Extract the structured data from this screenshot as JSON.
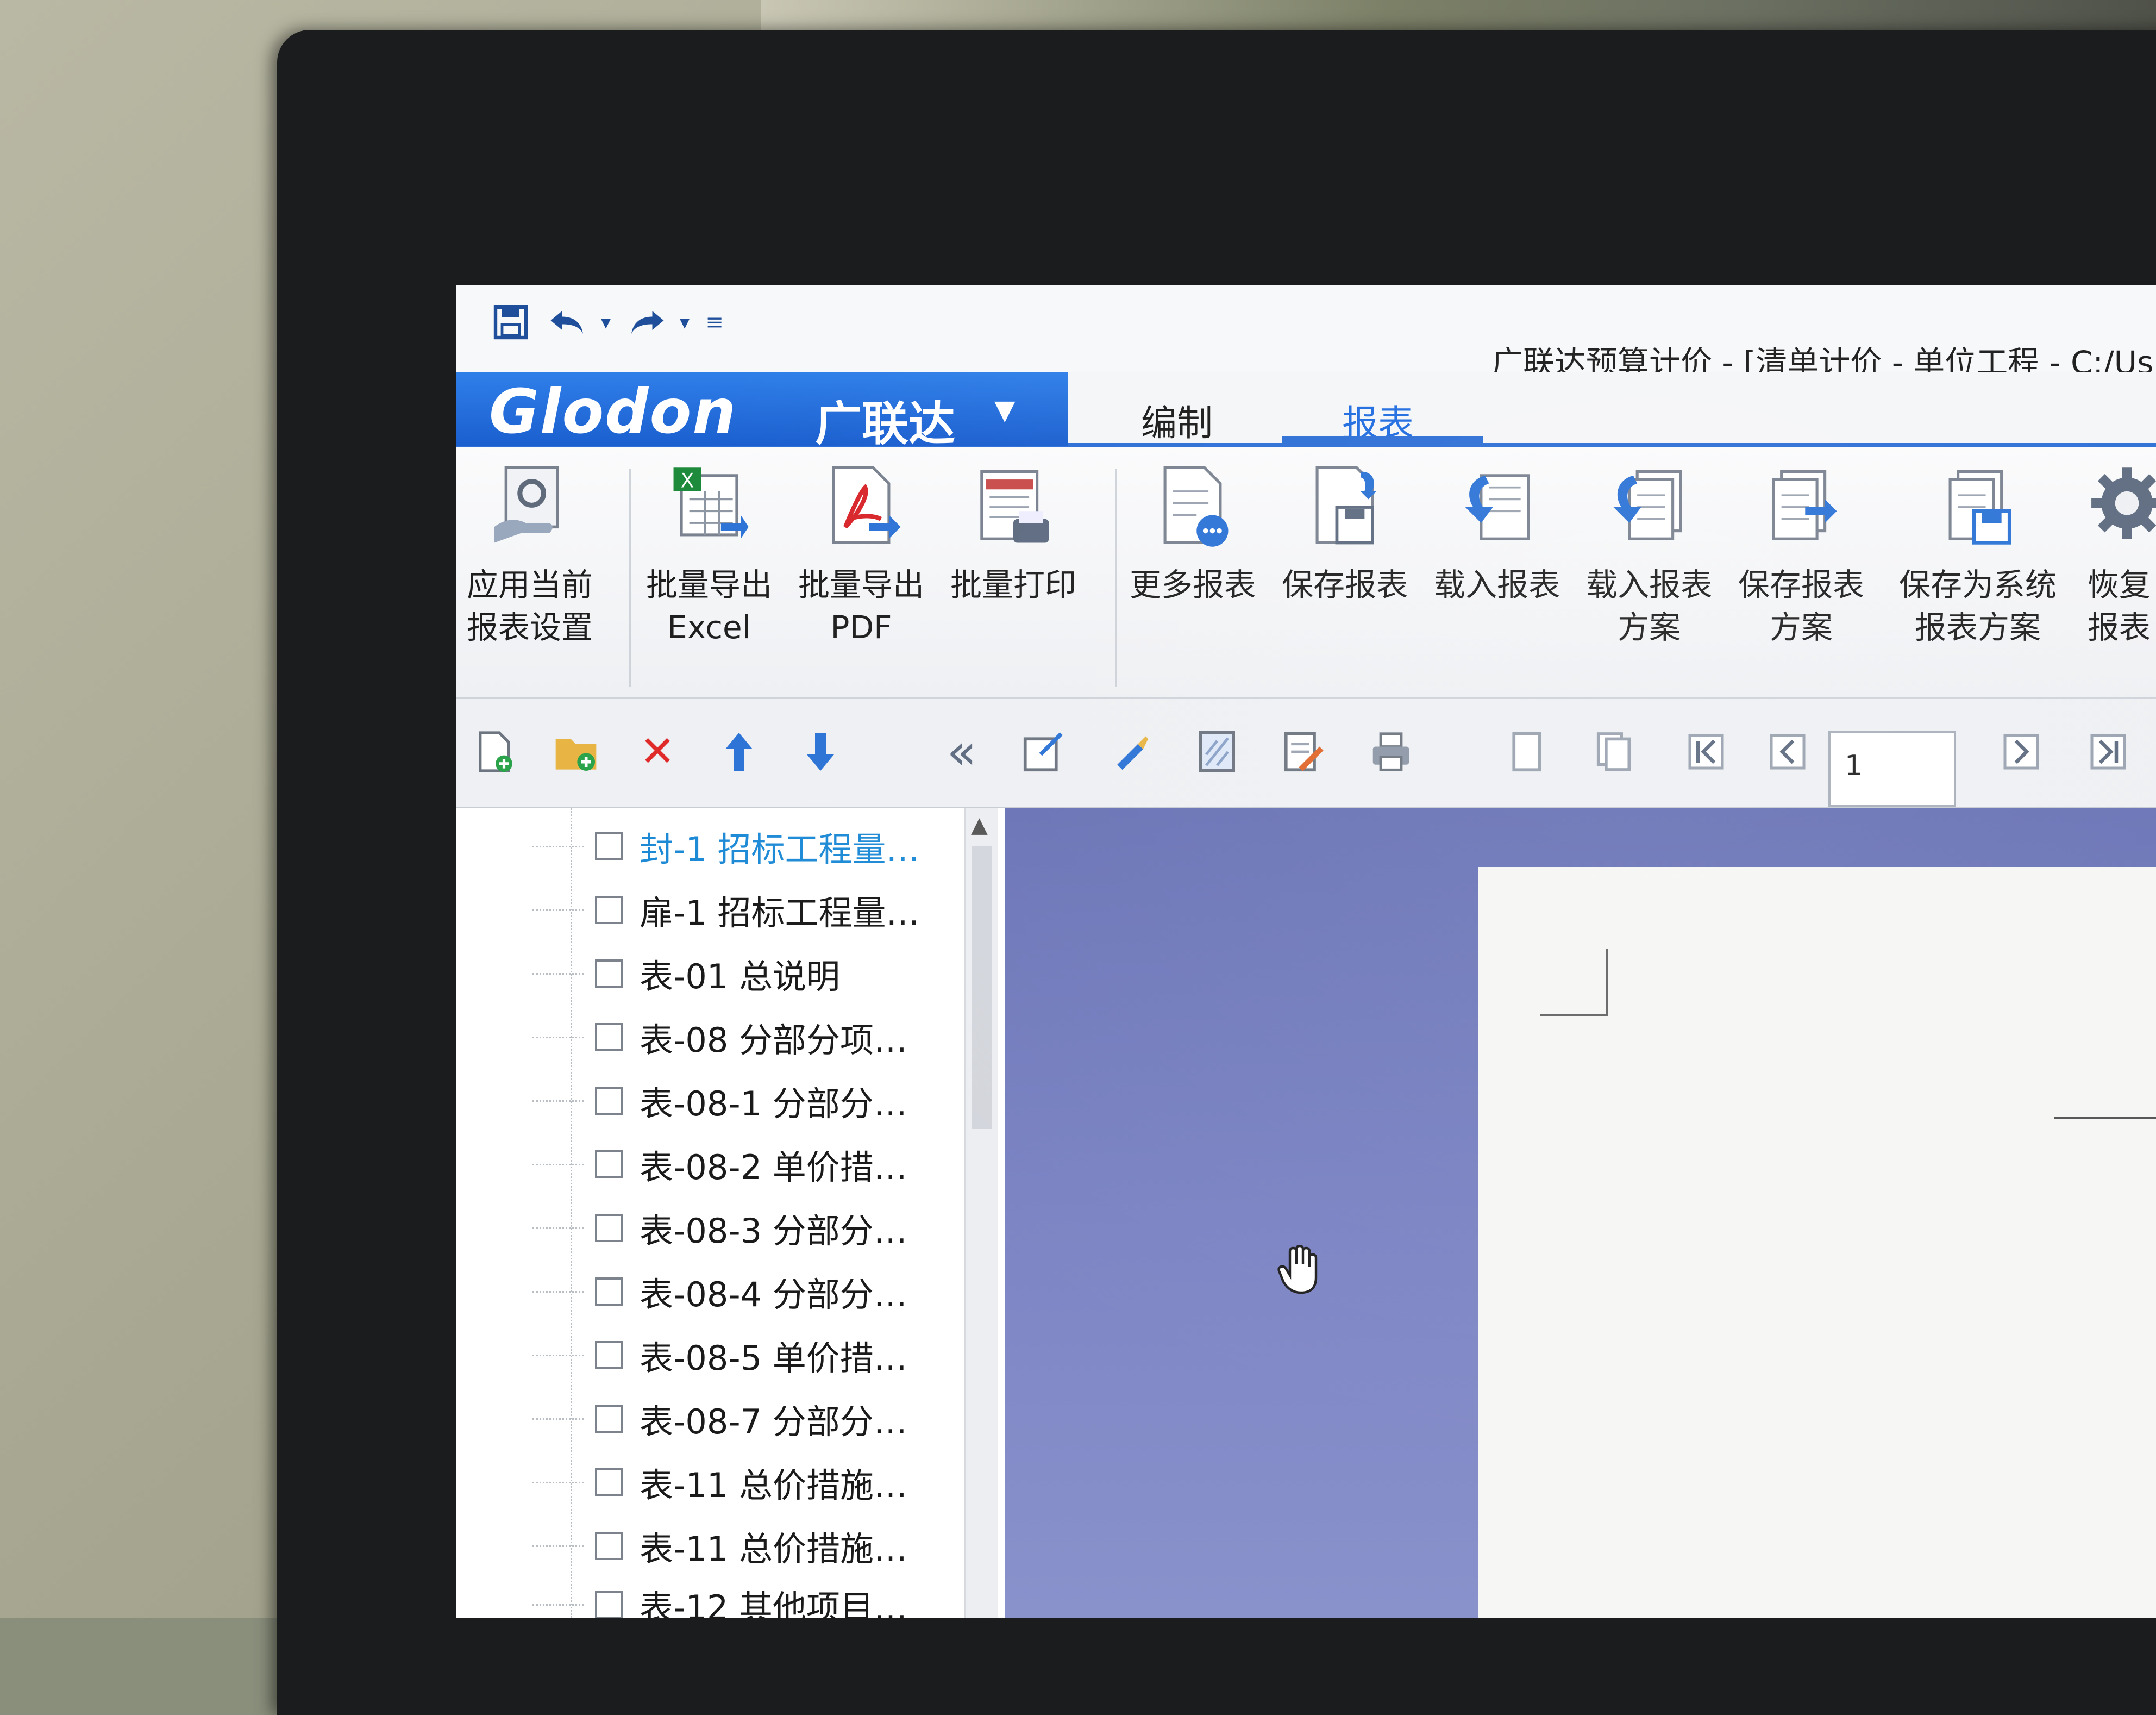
{
  "window": {
    "title": "广联达预算计价 - [清单计价 - 单位工程 - C:/Us"
  },
  "quick_access": {
    "save_icon": "save-icon",
    "undo_icon": "undo-icon",
    "redo_icon": "redo-icon",
    "customize_icon": "customize-icon"
  },
  "brand": {
    "logo": "Glodon",
    "name": "广联达"
  },
  "tabs": [
    {
      "label": "编制"
    },
    {
      "label": "报表",
      "active": true
    }
  ],
  "ribbon": [
    {
      "line1": "应用当前",
      "line2": "报表设置",
      "icon": "apply-settings-icon"
    },
    {
      "line1": "批量导出",
      "line2": "Excel",
      "icon": "excel-export-icon"
    },
    {
      "line1": "批量导出",
      "line2": "PDF",
      "icon": "pdf-export-icon"
    },
    {
      "line1": "批量打印",
      "line2": "",
      "icon": "batch-print-icon"
    },
    {
      "line1": "更多报表",
      "line2": "",
      "icon": "more-reports-icon"
    },
    {
      "line1": "保存报表",
      "line2": "",
      "icon": "save-report-icon"
    },
    {
      "line1": "载入报表",
      "line2": "",
      "icon": "load-report-icon"
    },
    {
      "line1": "载入报表",
      "line2": "方案",
      "icon": "load-scheme-icon"
    },
    {
      "line1": "保存报表",
      "line2": "方案",
      "icon": "save-scheme-icon"
    },
    {
      "line1": "保存为系统",
      "line2": "报表方案",
      "icon": "save-system-scheme-icon"
    },
    {
      "line1": "恢复",
      "line2": "报表",
      "icon": "restore-icon"
    }
  ],
  "toolbar": {
    "page_number": "1"
  },
  "tree_items": [
    {
      "label": "封-1 招标工程量…",
      "selected": true
    },
    {
      "label": "扉-1 招标工程量…"
    },
    {
      "label": "表-01 总说明"
    },
    {
      "label": "表-08 分部分项…"
    },
    {
      "label": "表-08-1 分部分…"
    },
    {
      "label": "表-08-2 单价措…"
    },
    {
      "label": "表-08-3 分部分…"
    },
    {
      "label": "表-08-4 分部分…"
    },
    {
      "label": "表-08-5 单价措…"
    },
    {
      "label": "表-08-7 分部分…"
    },
    {
      "label": "表-11 总价措施…"
    },
    {
      "label": "表-11 总价措施…"
    },
    {
      "label": "表-12 其他项目…"
    }
  ],
  "colors": {
    "brand_blue": "#1b5fcf",
    "tab_active": "#1e6be0",
    "preview_bg": "#7c84c4",
    "selected_item": "#1e8ad6"
  }
}
